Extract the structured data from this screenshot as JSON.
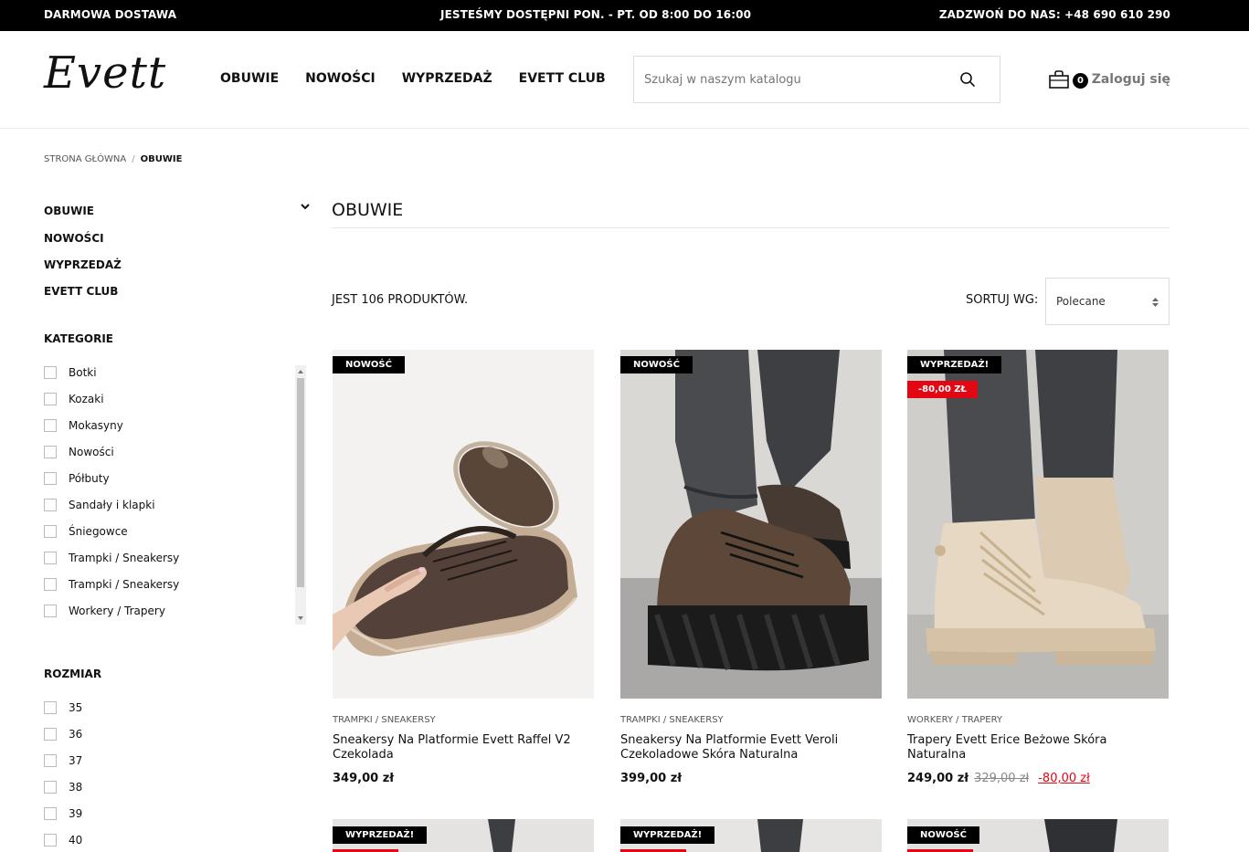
{
  "topbar": {
    "left": "DARMOWA DOSTAWA",
    "center": "JESTEŚMY DOSTĘPNI PON. - PT. OD 8:00 DO 16:00",
    "right": "ZADZWOŃ DO NAS: +48 690 610 290"
  },
  "header": {
    "logo": "Evett",
    "nav": [
      "OBUWIE",
      "NOWOŚCI",
      "WYPRZEDAŻ",
      "EVETT CLUB"
    ],
    "search_placeholder": "Szukaj w naszym katalogu",
    "cart_count": "0",
    "login": "Zaloguj się"
  },
  "breadcrumb": {
    "home": "STRONA GŁÓWNA",
    "separator": "/",
    "current": "OBUWIE"
  },
  "sidebar": {
    "nav": [
      "OBUWIE",
      "NOWOŚCI",
      "WYPRZEDAŻ",
      "EVETT CLUB"
    ],
    "categories_title": "KATEGORIE",
    "categories": [
      "Botki",
      "Kozaki",
      "Mokasyny",
      "Nowości",
      "Półbuty",
      "Sandały i klapki",
      "Śniegowce",
      "Trampki / Sneakersy",
      "Trampki / Sneakersy",
      "Workery / Trapery"
    ],
    "size_title": "ROZMIAR",
    "sizes": [
      "35",
      "36",
      "37",
      "38",
      "39",
      "40"
    ]
  },
  "main": {
    "title": "OBUWIE",
    "count": "JEST 106 PRODUKTÓW.",
    "sort_label": "SORTUJ WG:",
    "sort_value": "Polecane"
  },
  "products": [
    {
      "badge": "NOWOŚĆ",
      "category": "TRAMPKI / SNEAKERSY",
      "name": "Sneakersy Na Platformie Evett Raffel V2 Czekolada",
      "price": "349,00 zł"
    },
    {
      "badge": "NOWOŚĆ",
      "category": "TRAMPKI / SNEAKERSY",
      "name": "Sneakersy Na Platformie Evett Veroli Czekoladowe Skóra Naturalna",
      "price": "399,00 zł"
    },
    {
      "badge": "WYPRZEDAŻ!",
      "discount_badge": "-80,00 ZŁ",
      "category": "WORKERY / TRAPERY",
      "name": "Trapery Evett Erice Beżowe Skóra Naturalna",
      "price": "249,00 zł",
      "old_price": "329,00 zł",
      "discount": "-80,00 zł"
    }
  ],
  "products_row2": [
    {
      "badge": "WYPRZEDAŻ!"
    },
    {
      "badge": "WYPRZEDAŻ!"
    },
    {
      "badge": "NOWOŚĆ"
    }
  ],
  "colors": {
    "accent_red": "#e30613",
    "black": "#000000"
  }
}
